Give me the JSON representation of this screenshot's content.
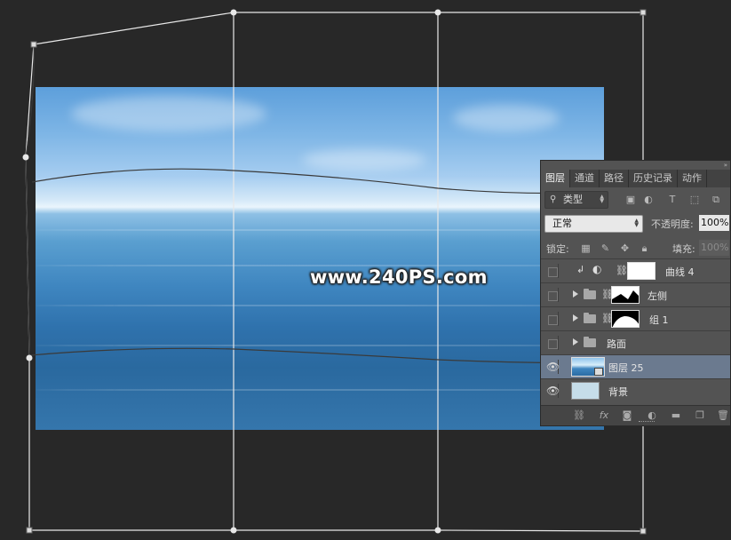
{
  "watermark": "www.240PS.com",
  "layers_panel": {
    "tabs": [
      "图层",
      "通道",
      "路径",
      "历史记录",
      "动作"
    ],
    "active_tab": "图层",
    "filter_kind": "类型",
    "blend_mode": "正常",
    "opacity_label": "不透明度:",
    "opacity_value": "100%",
    "lock_label": "锁定:",
    "fill_label": "填充:",
    "fill_value": "100%",
    "layers": [
      {
        "name": "曲线 4",
        "type": "adjustment",
        "visible": false,
        "clipped": true
      },
      {
        "name": "左侧",
        "type": "group",
        "visible": false
      },
      {
        "name": "组 1",
        "type": "group",
        "visible": false
      },
      {
        "name": "路面",
        "type": "group",
        "visible": false
      },
      {
        "name": "图层 25",
        "type": "smart-object",
        "visible": true,
        "selected": true
      },
      {
        "name": "背景",
        "type": "background",
        "visible": true
      }
    ]
  },
  "icons": {
    "filter": [
      "image-filter-icon",
      "adjustment-filter-icon",
      "type-filter-icon",
      "shape-filter-icon",
      "smart-object-filter-icon"
    ],
    "lock": [
      "lock-transparent-icon",
      "lock-brush-icon",
      "lock-move-icon",
      "lock-all-icon"
    ],
    "footer": [
      "link-layers-icon",
      "fx-icon",
      "add-mask-icon",
      "new-adjustment-icon",
      "new-group-icon",
      "new-layer-icon",
      "delete-layer-icon"
    ]
  },
  "colors": {
    "app_background": "#282828",
    "panel_background": "#535353",
    "selected_row": "#6b7a8f"
  }
}
